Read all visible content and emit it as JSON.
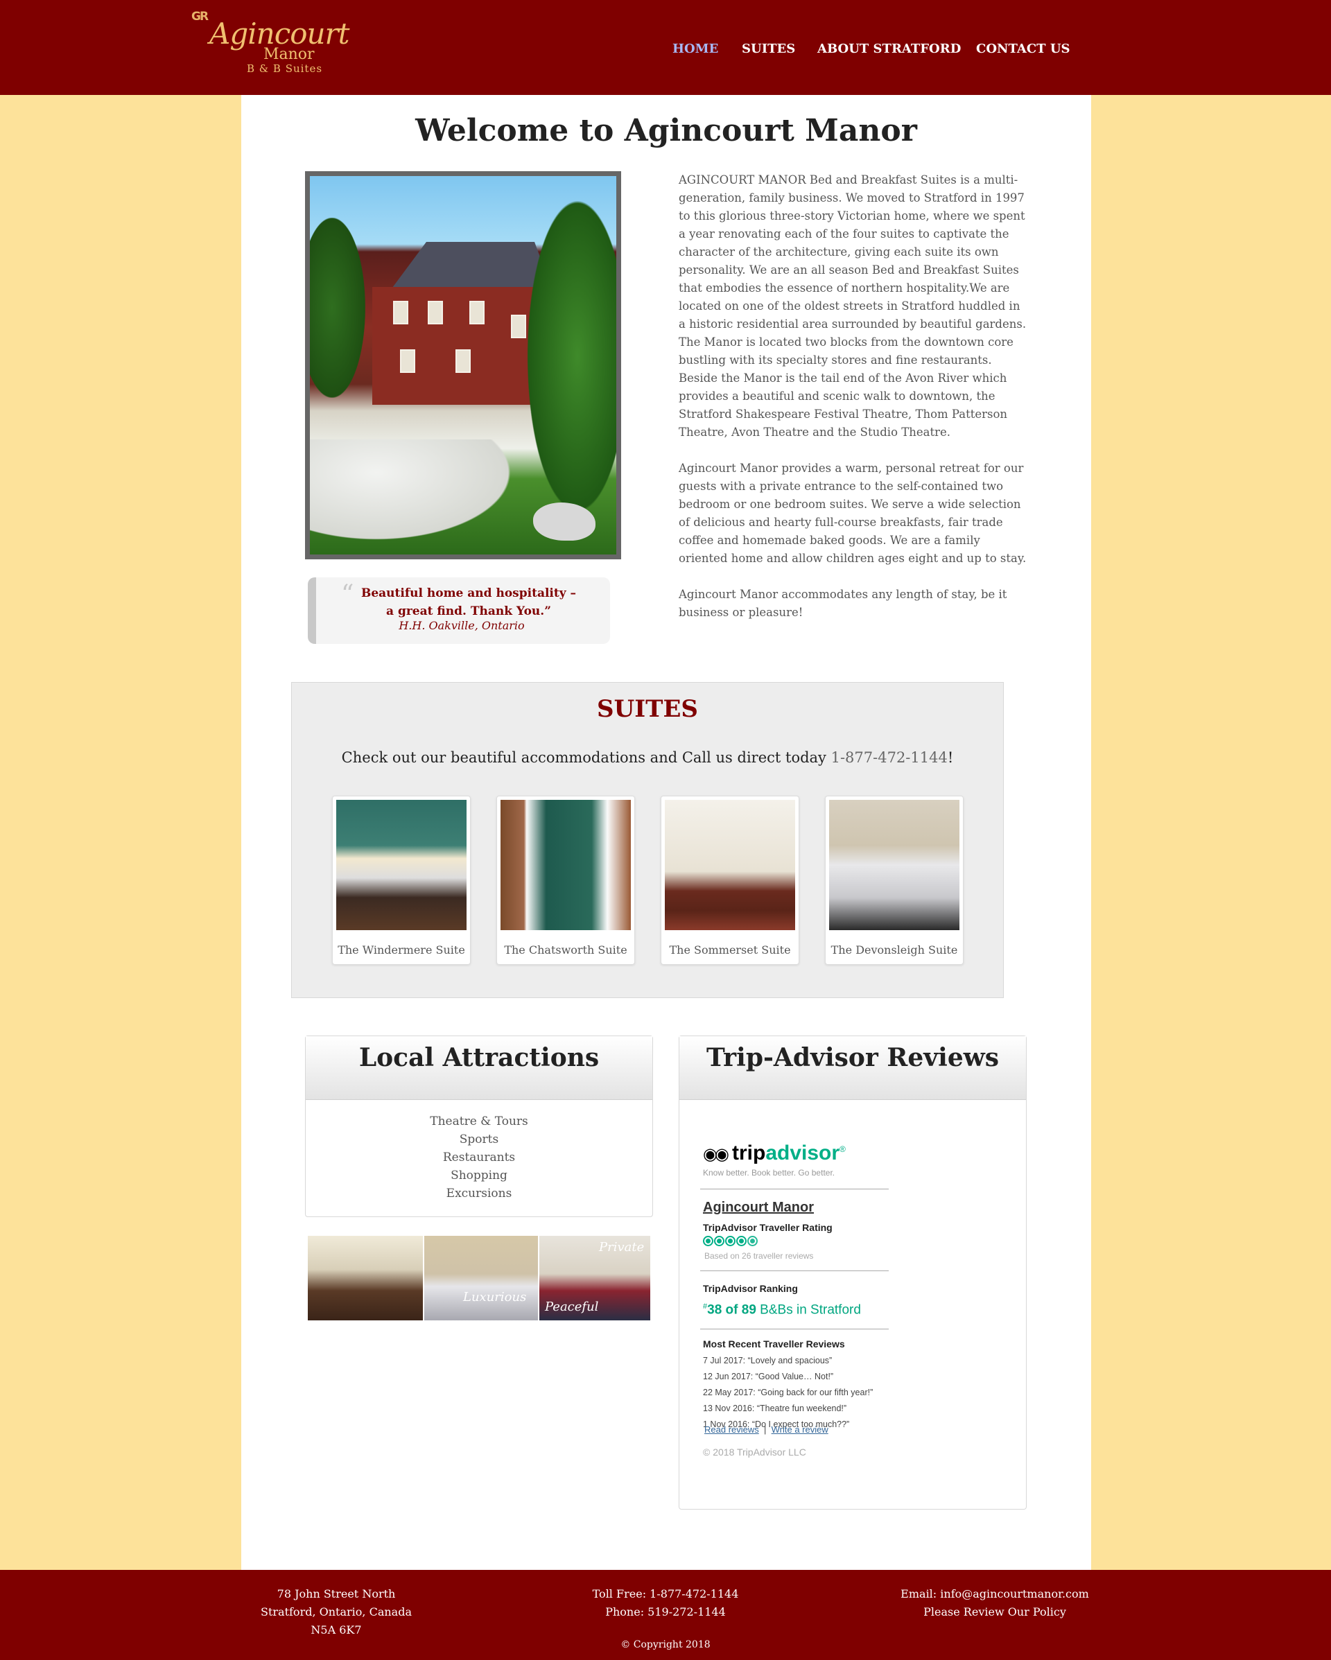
{
  "header": {
    "logo": {
      "mark": "GR",
      "brand": "Agincourt",
      "sub": "Manor",
      "tagline": "B & B Suites"
    },
    "nav": [
      {
        "label": "HOME",
        "active": true
      },
      {
        "label": "SUITES",
        "active": false
      },
      {
        "label": "ABOUT STRATFORD",
        "active": false
      },
      {
        "label": "CONTACT US",
        "active": false
      }
    ]
  },
  "main": {
    "title": "Welcome to Agincourt Manor",
    "intro": [
      "AGINCOURT MANOR Bed and Breakfast Suites is a multi-generation, family business. We moved to Stratford in 1997 to this glorious three-story Victorian home, where we spent a year renovating each of the four suites to captivate the character of the architecture, giving each suite its own personality. We are an all season Bed and Breakfast Suites that embodies the essence of northern hospitality.We are located on one of the oldest streets in Stratford huddled in a historic residential area surrounded by beautiful gardens. The Manor is located two blocks from the downtown core bustling with its specialty stores and fine restaurants. Beside the Manor is the tail end of the Avon River which provides a beautiful and scenic walk to downtown, the Stratford Shakespeare Festival Theatre, Thom Patterson Theatre, Avon Theatre and the Studio Theatre.",
      "Agincourt Manor provides a warm, personal retreat for our guests with a private entrance to the self-contained two bedroom or one bedroom suites. We serve a wide selection of delicious and hearty full-course breakfasts, fair trade coffee and homemade baked goods. We are a family oriented home and allow children ages eight and up to stay.",
      "Agincourt Manor accommodates any length of stay, be it business or pleasure!"
    ],
    "testimonial": {
      "quote": "Beautiful home and hospitality – a great find. Thank You.”",
      "author": "H.H. Oakville, Ontario"
    }
  },
  "suites": {
    "title": "SUITES",
    "subtitle_prefix": "Check out our beautiful accommodations and Call us direct today ",
    "phone": "1-877-472-1144",
    "subtitle_suffix": "!",
    "items": [
      {
        "name": "The Windermere Suite"
      },
      {
        "name": "The Chatsworth Suite"
      },
      {
        "name": "The Sommerset Suite"
      },
      {
        "name": "The Devonsleigh Suite"
      }
    ]
  },
  "attractions": {
    "title": "Local Attractions",
    "items": [
      "Theatre & Tours",
      "Sports",
      "Restaurants",
      "Shopping",
      "Excursions"
    ],
    "collage_words": [
      "Luxurious",
      "Peaceful",
      "Private"
    ]
  },
  "tripadvisor": {
    "title": "Trip-Advisor Reviews",
    "logo_a": "trip",
    "logo_b": "advisor",
    "logo_r": "®",
    "tagline": "Know better. Book better. Go better.",
    "property": "Agincourt Manor",
    "rating_label": "TripAdvisor Traveller Rating",
    "rating_value": 4.5,
    "based_on": "Based on 26 traveller reviews",
    "ranking_label": "TripAdvisor Ranking",
    "rank_hash": "#",
    "rank": "38 of 89",
    "rank_suffix": "B&Bs in Stratford",
    "recent_label": "Most Recent Traveller Reviews",
    "reviews": [
      "7 Jul 2017: “Lovely and spacious”",
      "12 Jun 2017: “Good Value… Not!”",
      "22 May 2017: “Going back for our fifth year!”",
      "13 Nov 2016: “Theatre fun weekend!”",
      "1 Nov 2016: “Do I expect too much??”"
    ],
    "read_link": "Read reviews",
    "separator": "|",
    "write_link": "Write a review",
    "copyright": "© 2018 TripAdvisor LLC"
  },
  "footer": {
    "address": [
      "78 John Street North",
      "Stratford, Ontario, Canada",
      "N5A 6K7"
    ],
    "phones": [
      "Toll Free: 1-877-472-1144",
      "Phone: 519-272-1144"
    ],
    "email": "Email: info@agincourtmanor.com",
    "review_link": "Please Review Our Policy",
    "copyright": "© Copyright 2018"
  },
  "colors": {
    "brand": "#7f0000",
    "page_bg": "#fde29a",
    "nav_active": "#a8b8f5",
    "ta_green": "#00af87"
  }
}
